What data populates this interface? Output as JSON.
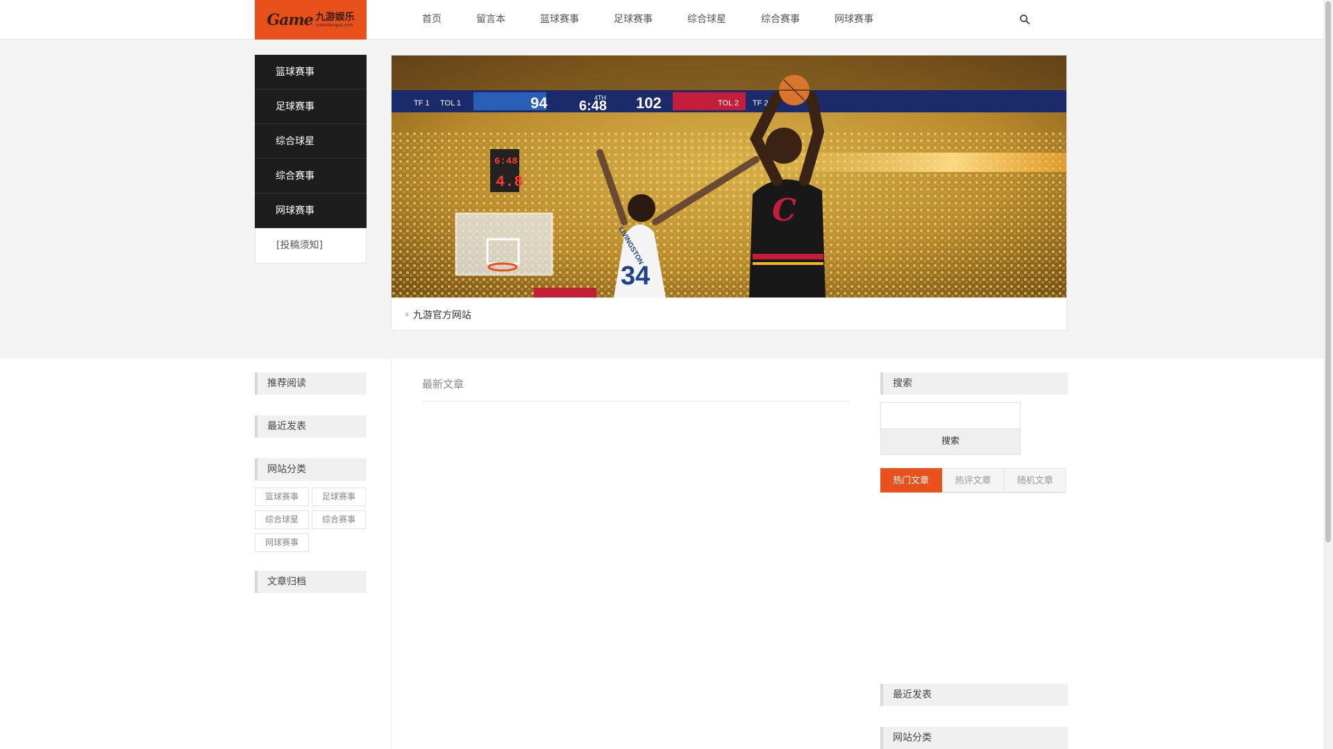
{
  "header": {
    "logo_mark": "Game",
    "logo_cn": "九游娱乐",
    "logo_url": "nuevolengua.com",
    "nav": [
      "首页",
      "留言本",
      "篮球赛事",
      "足球赛事",
      "综合球星",
      "综合赛事",
      "网球赛事"
    ],
    "search_icon": "search-icon"
  },
  "banner": {
    "menu": [
      "篮球赛事",
      "足球赛事",
      "综合球星",
      "综合赛事",
      "网球赛事"
    ],
    "notice": "[投稿须知]",
    "caption": "◦ 九游官方网站",
    "scoreboard": {
      "left_team": "TOL 1",
      "left_score": "94",
      "quarter": "4TH",
      "clock": "6:48",
      "right_score": "102",
      "right_team": "TOL 2",
      "shot_clock_time": "6:48",
      "shot_clock": "4.8",
      "jersey_name": "LIVINGSTON",
      "jersey_number": "34"
    }
  },
  "left": {
    "recommended": "推荐阅读",
    "recent": "最近发表",
    "categories_title": "网站分类",
    "categories": [
      "篮球赛事",
      "足球赛事",
      "综合球星",
      "综合赛事",
      "网球赛事"
    ],
    "archive": "文章归档"
  },
  "main": {
    "title": "最新文章"
  },
  "right": {
    "search_title": "搜索",
    "search_button": "搜索",
    "tabs": [
      "热门文章",
      "热评文章",
      "随机文章"
    ],
    "recent": "最近发表",
    "categories_title": "网站分类"
  },
  "colors": {
    "accent": "#e8501c",
    "menu_bg": "#1d1d1d"
  }
}
